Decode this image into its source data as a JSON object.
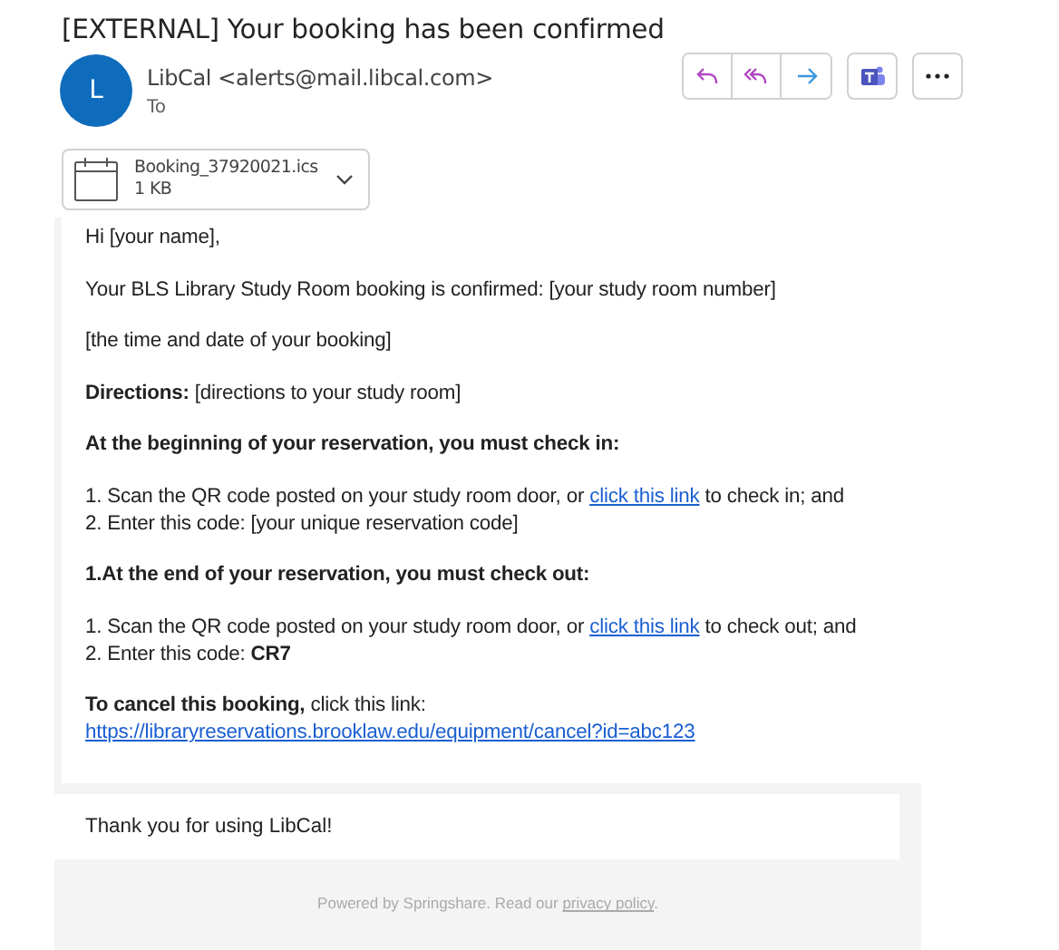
{
  "subject": "[EXTERNAL] Your booking has been confirmed",
  "sender": {
    "avatar_letter": "L",
    "from": "LibCal <alerts@mail.libcal.com>",
    "to_label": "To"
  },
  "attachment": {
    "name": "Booking_37920021.ics",
    "size": "1 KB"
  },
  "body": [
    [
      [
        {
          "kind": "plain",
          "text": "Hi [your name],"
        }
      ]
    ],
    [
      [
        {
          "kind": "plain",
          "text": "Your BLS Library Study Room booking is confirmed: [your study room number]"
        }
      ]
    ],
    [
      [
        {
          "kind": "plain",
          "text": "[the time and date of your booking]"
        }
      ]
    ],
    [
      [
        {
          "kind": "bold",
          "text": "Directions:"
        },
        {
          "kind": "plain",
          "text": " [directions to your study room]"
        }
      ]
    ],
    [
      [
        {
          "kind": "bold",
          "text": "At the beginning of your reservation, you must check in:"
        }
      ]
    ],
    [
      [
        {
          "kind": "plain",
          "text": "1. Scan the QR code posted on your study room door, or "
        },
        {
          "kind": "link",
          "text": "click this link"
        },
        {
          "kind": "plain",
          "text": " to check in; and"
        }
      ],
      [
        {
          "kind": "plain",
          "text": "2. Enter this code: [your unique reservation code]"
        }
      ]
    ],
    [
      [
        {
          "kind": "bold",
          "text": "1.At the end of your reservation, you must check out:"
        }
      ]
    ],
    [
      [
        {
          "kind": "plain",
          "text": "1. Scan the QR code posted on your study room door, or "
        },
        {
          "kind": "link",
          "text": "click this link"
        },
        {
          "kind": "plain",
          "text": " to check out; and"
        }
      ],
      [
        {
          "kind": "plain",
          "text": "2. Enter this code: "
        },
        {
          "kind": "bold",
          "text": "CR7"
        }
      ]
    ],
    [
      [
        {
          "kind": "bold",
          "text": "To cancel this booking,"
        },
        {
          "kind": "plain",
          "text": " click this link:"
        }
      ],
      [
        {
          "kind": "link",
          "text": "https://libraryreservations.brooklaw.edu/equipment/cancel?id=abc123"
        }
      ]
    ]
  ],
  "closing": "Thank you for using LibCal!",
  "footer": [
    {
      "kind": "plain",
      "text": "Powered by Springshare. Read our "
    },
    {
      "kind": "link",
      "text": "privacy policy"
    },
    {
      "kind": "plain",
      "text": "."
    }
  ]
}
